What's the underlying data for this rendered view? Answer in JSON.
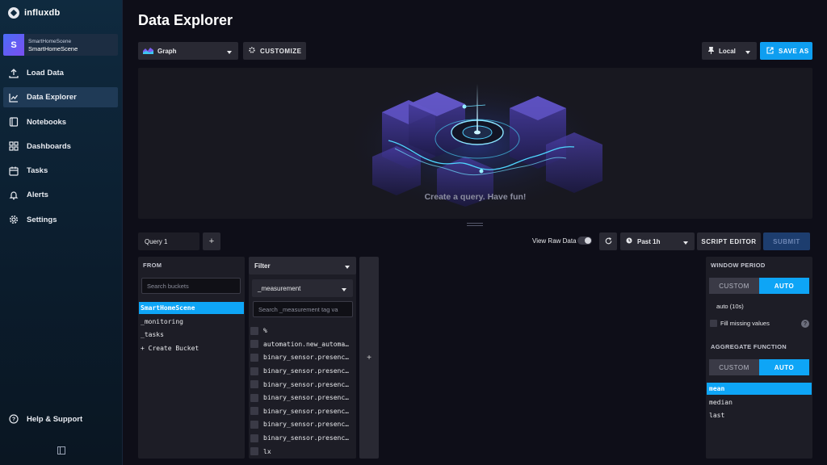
{
  "brand": {
    "name": "influxdb"
  },
  "org": {
    "avatar": "S",
    "small_name": "SmartHomeScene",
    "name": "SmartHomeScene"
  },
  "nav": {
    "items": [
      {
        "label": "Load Data",
        "icon": "upload-icon"
      },
      {
        "label": "Data Explorer",
        "icon": "graph-icon",
        "active": true
      },
      {
        "label": "Notebooks",
        "icon": "notebook-icon"
      },
      {
        "label": "Dashboards",
        "icon": "dashboard-icon"
      },
      {
        "label": "Tasks",
        "icon": "calendar-icon"
      },
      {
        "label": "Alerts",
        "icon": "bell-icon"
      },
      {
        "label": "Settings",
        "icon": "gear-icon"
      }
    ],
    "help": "Help & Support"
  },
  "page": {
    "title": "Data Explorer"
  },
  "toolbar": {
    "viz_type": "Graph",
    "customize": "CUSTOMIZE",
    "timezone": "Local",
    "save_as": "SAVE AS"
  },
  "graph": {
    "empty_message": "Create a query. Have fun!"
  },
  "query": {
    "tab": "Query 1",
    "add": "+",
    "view_raw": "View Raw Data",
    "time_range": "Past 1h",
    "script_editor": "SCRIPT EDITOR",
    "submit": "SUBMIT"
  },
  "from": {
    "heading": "FROM",
    "search_placeholder": "Search buckets",
    "buckets": [
      "SmartHomeScene",
      "_monitoring",
      "_tasks",
      "+ Create Bucket"
    ]
  },
  "filter": {
    "heading": "Filter",
    "key": "_measurement",
    "search_placeholder": "Search _measurement tag va",
    "tags": [
      "%",
      "automation.new_automa…",
      "binary_sensor.presenc…",
      "binary_sensor.presenc…",
      "binary_sensor.presenc…",
      "binary_sensor.presenc…",
      "binary_sensor.presenc…",
      "binary_sensor.presenc…",
      "binary_sensor.presenc…",
      "lx"
    ],
    "add": "+"
  },
  "aggregate": {
    "window_heading": "WINDOW PERIOD",
    "custom": "CUSTOM",
    "auto": "AUTO",
    "auto_value": "auto (10s)",
    "fill_missing": "Fill missing values",
    "info": "?",
    "function_heading": "AGGREGATE FUNCTION",
    "functions": [
      "mean",
      "median",
      "last"
    ]
  },
  "colors": {
    "accent": "#0ea5f6",
    "sidebar_active": "#1f3a56",
    "panel": "#1d1d26"
  }
}
